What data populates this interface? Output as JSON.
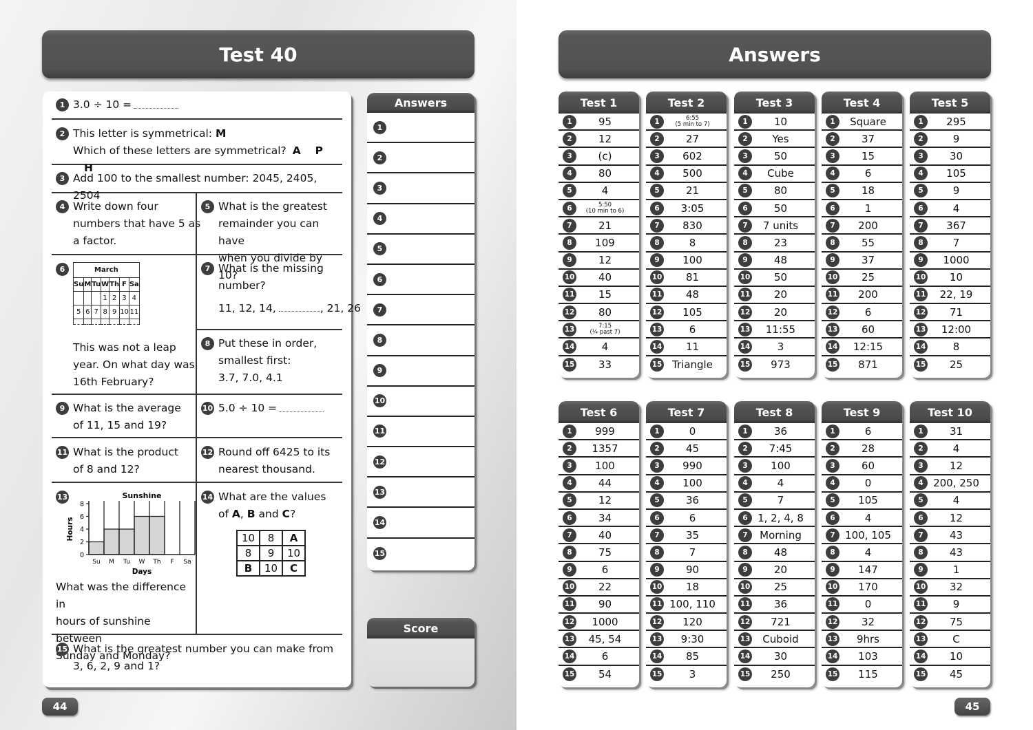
{
  "left_page": {
    "title": "Test 40",
    "page_number": "44",
    "questions": {
      "q1": {
        "num": "1",
        "text": "3.0 ÷ 10 ="
      },
      "q2": {
        "num": "2",
        "line1": "This letter is symmetrical:",
        "letter": "M",
        "line2": "Which of these letters are symmetrical?",
        "options": [
          "A",
          "P",
          "H"
        ]
      },
      "q3": {
        "num": "3",
        "text": "Add 100 to the smallest number: 2045, 2405, 2504"
      },
      "q4": {
        "num": "4",
        "lines": [
          "Write down four",
          "numbers that have 5 as",
          "a factor."
        ]
      },
      "q5": {
        "num": "5",
        "lines": [
          "What is the greatest",
          "remainder you can have",
          "when you divide by 10?"
        ]
      },
      "q6": {
        "num": "6",
        "calendar": {
          "month": "March",
          "days": [
            "Su",
            "M",
            "Tu",
            "W",
            "Th",
            "F",
            "Sa"
          ],
          "week1": [
            "",
            "",
            "",
            "1",
            "2",
            "3",
            "4"
          ],
          "week2": [
            "5",
            "6",
            "7",
            "8",
            "9",
            "10",
            "11"
          ]
        },
        "lines": [
          "This was not a leap",
          "year. On what day was",
          "16th February?"
        ]
      },
      "q7": {
        "num": "7",
        "lines": [
          "What is the missing",
          "number?"
        ],
        "sequence_start": "11, 12, 14,",
        "sequence_end": ", 21, 26"
      },
      "q8": {
        "num": "8",
        "lines": [
          "Put these in order,",
          "smallest first:",
          "3.7, 7.0, 4.1"
        ]
      },
      "q9": {
        "num": "9",
        "lines": [
          "What is the average",
          "of 11, 15 and 19?"
        ]
      },
      "q10": {
        "num": "10",
        "text": "5.0 ÷ 10 ="
      },
      "q11": {
        "num": "11",
        "lines": [
          "What is the product",
          "of 8 and 12?"
        ]
      },
      "q12": {
        "num": "12",
        "lines": [
          "Round off 6425 to its",
          "nearest thousand."
        ]
      },
      "q13": {
        "num": "13",
        "lines": [
          "What was the difference in",
          "hours of sunshine between",
          "Sunday and Monday?"
        ]
      },
      "q14": {
        "num": "14",
        "line1": "What are the values",
        "line2_prefix": "of",
        "a": "A",
        "sep1": ",",
        "b": "B",
        "and": "and",
        "c": "C",
        "q": "?",
        "grid": [
          [
            "10",
            "8",
            "A"
          ],
          [
            "8",
            "9",
            "10"
          ],
          [
            "B",
            "10",
            "C"
          ]
        ]
      },
      "q15": {
        "num": "15",
        "lines": [
          "What is the greatest number you can make from",
          "3, 6, 2, 9 and 1?"
        ]
      }
    },
    "answers_panel": {
      "title": "Answers",
      "numbers": [
        "1",
        "2",
        "3",
        "4",
        "5",
        "6",
        "7",
        "8",
        "9",
        "10",
        "11",
        "12",
        "13",
        "14",
        "15"
      ]
    },
    "score_panel": {
      "title": "Score"
    }
  },
  "chart_data": {
    "type": "bar",
    "title": "Sunshine",
    "xlabel": "Days",
    "ylabel": "Hours",
    "categories": [
      "Su",
      "M",
      "Tu",
      "W",
      "Th",
      "F",
      "Sa"
    ],
    "values": [
      2,
      4,
      4,
      6,
      6,
      0,
      0
    ],
    "ylim": [
      0,
      8
    ],
    "yticks": [
      "0",
      "2",
      "4",
      "6",
      "8"
    ],
    "grid": false
  },
  "right_page": {
    "title": "Answers",
    "page_number": "45",
    "tests": [
      {
        "name": "Test 1",
        "answers": [
          "95",
          "12",
          "(c)",
          "80",
          "4",
          {
            "main": "5:50",
            "sub": "(10 min to 6)"
          },
          "21",
          "109",
          "12",
          "40",
          "15",
          "80",
          {
            "main": "7:15",
            "sub": "(¼ past 7)"
          },
          "4",
          "33"
        ]
      },
      {
        "name": "Test 2",
        "answers": [
          {
            "main": "6:55",
            "sub": "(5 min to 7)"
          },
          "27",
          "602",
          "500",
          "21",
          "3:05",
          "830",
          "8",
          "100",
          "81",
          "48",
          "105",
          "6",
          "11",
          "Triangle"
        ]
      },
      {
        "name": "Test 3",
        "answers": [
          "10",
          "Yes",
          "50",
          "Cube",
          "80",
          "50",
          "7 units",
          "23",
          "48",
          "50",
          "20",
          "20",
          "11:55",
          "3",
          "973"
        ]
      },
      {
        "name": "Test 4",
        "answers": [
          "Square",
          "37",
          "15",
          "6",
          "18",
          "1",
          "200",
          "55",
          "37",
          "25",
          "200",
          "6",
          "60",
          "12:15",
          "871"
        ]
      },
      {
        "name": "Test 5",
        "answers": [
          "295",
          "9",
          "30",
          "105",
          "9",
          "4",
          "367",
          "7",
          "1000",
          "10",
          "22, 19",
          "71",
          "12:00",
          "8",
          "25"
        ]
      },
      {
        "name": "Test 6",
        "answers": [
          "999",
          "1357",
          "100",
          "44",
          "12",
          "34",
          "40",
          "75",
          "6",
          "22",
          "90",
          "1000",
          "45, 54",
          "6",
          "54"
        ]
      },
      {
        "name": "Test 7",
        "answers": [
          "0",
          "45",
          "990",
          "100",
          "36",
          "6",
          "35",
          "7",
          "90",
          "18",
          "100, 110",
          "120",
          "9:30",
          "85",
          "3"
        ]
      },
      {
        "name": "Test 8",
        "answers": [
          "36",
          "7:45",
          "100",
          "4",
          "7",
          "1, 2, 4, 8",
          "Morning",
          "48",
          "20",
          "25",
          "36",
          "721",
          "Cuboid",
          "30",
          "250"
        ]
      },
      {
        "name": "Test 9",
        "answers": [
          "6",
          "28",
          "60",
          "0",
          "105",
          "4",
          "100, 105",
          "4",
          "147",
          "170",
          "0",
          "32",
          "9hrs",
          "103",
          "115"
        ]
      },
      {
        "name": "Test 10",
        "answers": [
          "31",
          "4",
          "12",
          "200, 250",
          "4",
          "12",
          "43",
          "43",
          "1",
          "32",
          "9",
          "75",
          "C",
          "10",
          "45"
        ]
      }
    ]
  }
}
